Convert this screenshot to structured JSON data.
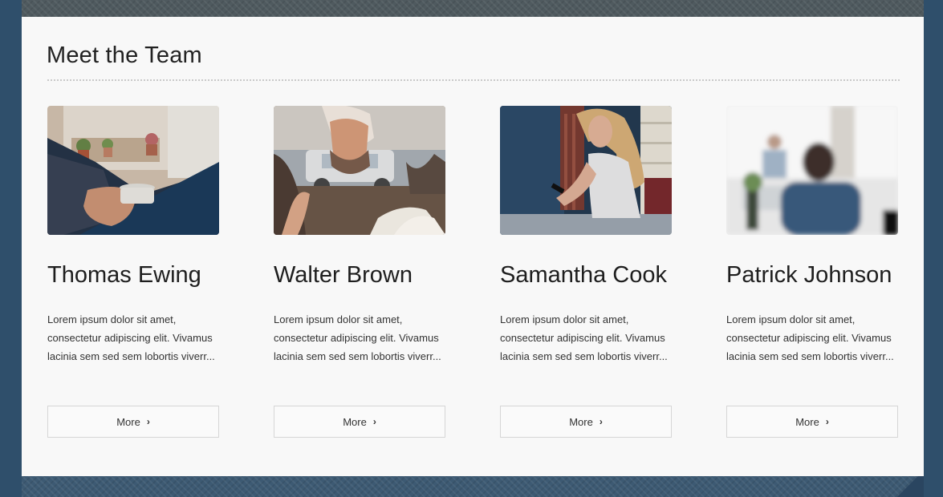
{
  "section": {
    "title": "Meet the Team"
  },
  "team": [
    {
      "name": "Thomas Ewing",
      "bio": "Lorem ipsum dolor sit amet, consectetur adipiscing elit. Vivamus lacinia sem sed sem lobortis viverr...",
      "button": "More",
      "photo_icon": "coffee-hand-photo"
    },
    {
      "name": "Walter Brown",
      "bio": "Lorem ipsum dolor sit amet, consectetur adipiscing elit. Vivamus lacinia sem sed sem lobortis viverr...",
      "button": "More",
      "photo_icon": "cafe-window-photo"
    },
    {
      "name": "Samantha Cook",
      "bio": "Lorem ipsum dolor sit amet, consectetur adipiscing elit. Vivamus lacinia sem sed sem lobortis viverr...",
      "button": "More",
      "photo_icon": "woman-phone-photo"
    },
    {
      "name": "Patrick Johnson",
      "bio": "Lorem ipsum dolor sit amet, consectetur adipiscing elit. Vivamus lacinia sem sed sem lobortis viverr...",
      "button": "More",
      "photo_icon": "blurred-office-photo"
    }
  ],
  "colors": {
    "background": "#34546f",
    "panel": "#f8f8f8",
    "text": "#222222",
    "button_border": "#d6d6d6"
  }
}
